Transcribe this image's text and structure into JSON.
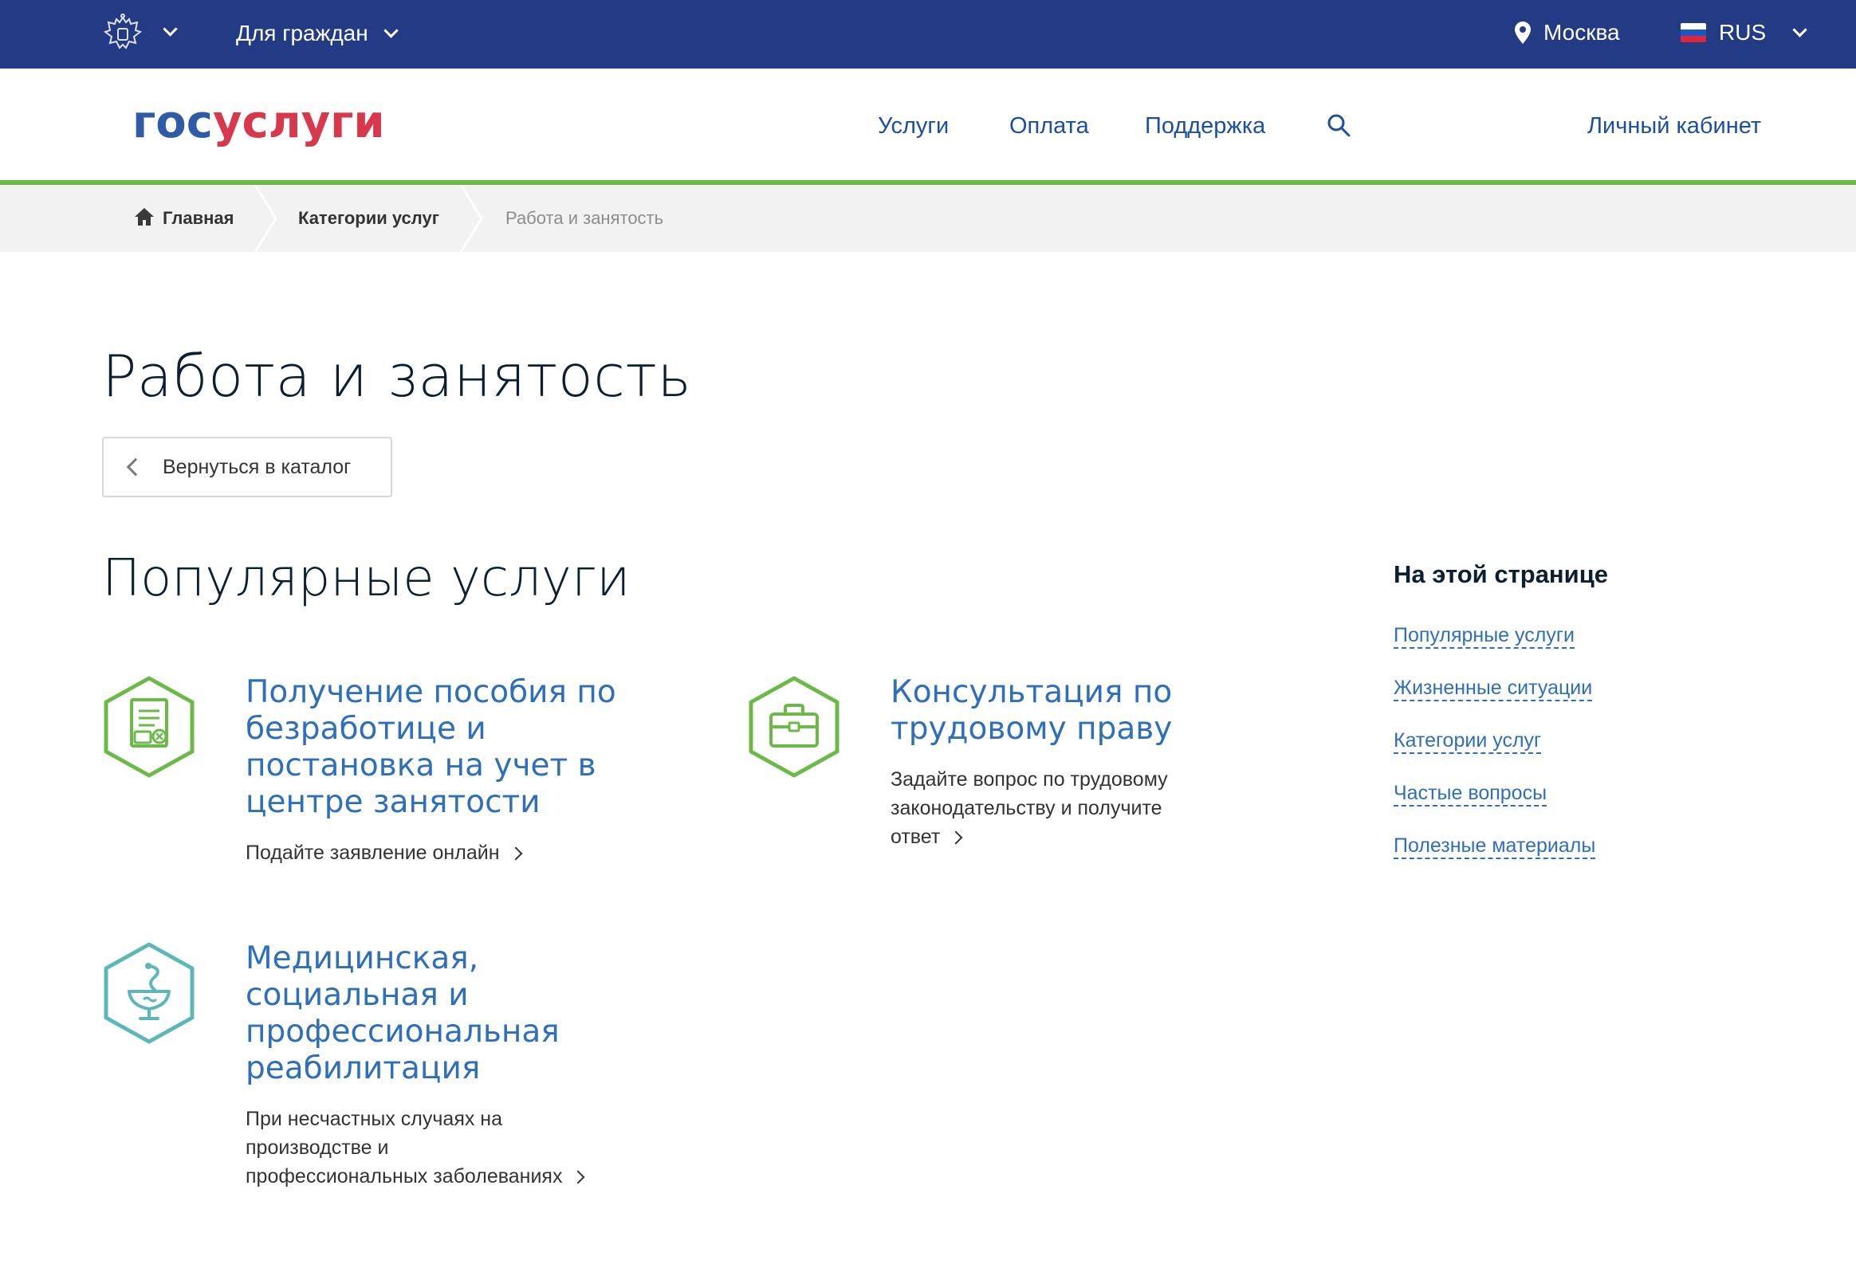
{
  "topbar": {
    "emblem_icon": "coat-of-arms-icon",
    "audience_label": "Для граждан",
    "city": "Москва",
    "language": "RUS"
  },
  "header": {
    "logo_part1": "гос",
    "logo_part2": "услуги",
    "nav": [
      "Услуги",
      "Оплата",
      "Поддержка"
    ],
    "cabinet": "Личный кабинет",
    "colors": {
      "brand_blue": "#2e5aa7",
      "brand_red": "#d7384c",
      "topbar": "#233a84",
      "accent_green": "#6bba47"
    }
  },
  "breadcrumb": {
    "home": "Главная",
    "categories": "Категории услуг",
    "current": "Работа и занятость"
  },
  "page": {
    "title": "Работа и занятость",
    "back_label": "Вернуться в каталог",
    "popular_title": "Популярные услуги"
  },
  "services": [
    {
      "icon": "document-icon",
      "title": [
        "Получение пособия по",
        "безработице и",
        "постановка на учет в",
        "центре занятости"
      ],
      "desc": [
        "Подайте заявление онлайн"
      ]
    },
    {
      "icon": "briefcase-icon",
      "title": [
        "Консультация по",
        "трудовому праву"
      ],
      "desc": [
        "Задайте вопрос по трудовому",
        "законодательству и получите",
        "ответ"
      ]
    },
    {
      "icon": "medical-icon",
      "title": [
        "Медицинская,",
        "социальная и",
        "профессиональная",
        "реабилитация"
      ],
      "desc": [
        "При несчастных случаях на",
        "производстве и",
        "профессиональных заболеваниях"
      ]
    }
  ],
  "sidebar": {
    "title": "На этой странице",
    "links": [
      "Популярные услуги",
      "Жизненные ситуации",
      "Категории услуг",
      "Частые вопросы",
      "Полезные материалы"
    ]
  }
}
